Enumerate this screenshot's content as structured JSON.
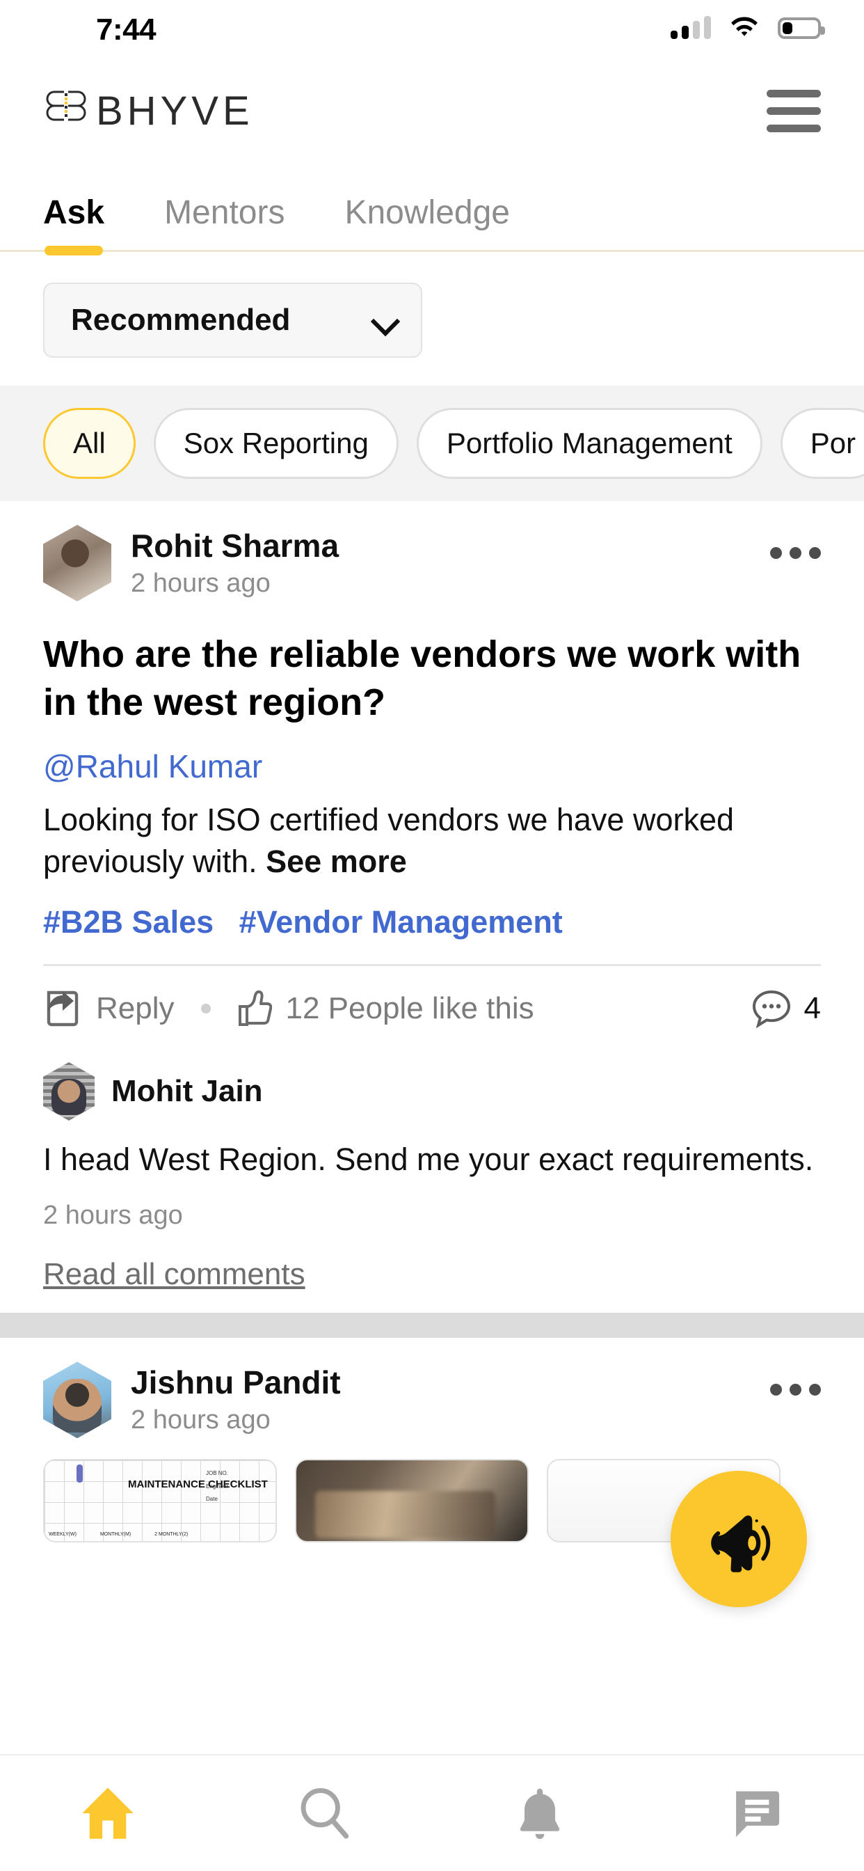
{
  "status_bar": {
    "time": "7:44",
    "signal_icon": "cellular-signal-icon",
    "signal_bars_filled": 2,
    "signal_bars_total": 4,
    "wifi_icon": "wifi-icon",
    "battery_icon": "battery-icon",
    "battery_level_percent": 30
  },
  "header": {
    "logo_text": "BHYVE",
    "logo_mark": "bhyve-butterfly-logo",
    "menu_icon": "hamburger-menu-icon"
  },
  "tabs": [
    {
      "label": "Ask",
      "active": true
    },
    {
      "label": "Mentors",
      "active": false
    },
    {
      "label": "Knowledge",
      "active": false
    }
  ],
  "sort": {
    "selected": "Recommended",
    "chevron_icon": "chevron-down-icon"
  },
  "filter_chips": [
    {
      "label": "All",
      "active": true
    },
    {
      "label": "Sox Reporting",
      "active": false
    },
    {
      "label": "Portfolio Management",
      "active": false
    },
    {
      "label": "Por",
      "active": false
    }
  ],
  "posts": [
    {
      "author": "Rohit Sharma",
      "time": "2 hours ago",
      "avatar": "user-avatar-rohit",
      "menu_icon": "post-options-icon",
      "title": "Who are the reliable vendors we work with in the west region?",
      "mention": "@Rahul Kumar",
      "body_text": "Looking for ISO certified vendors we have worked previously with.",
      "see_more": "See more",
      "tags": [
        "#B2B Sales",
        "#Vendor Management"
      ],
      "actions": {
        "reply_label": "Reply",
        "reply_icon": "reply-arrow-icon",
        "like_icon": "thumbs-up-icon",
        "likes_label": "12 People like this",
        "comment_icon": "comment-bubble-icon",
        "comment_count": "4"
      },
      "comment": {
        "author": "Mohit Jain",
        "avatar": "user-avatar-mohit",
        "text": "I head West Region. Send me your exact requirements.",
        "time": "2 hours ago"
      },
      "read_all_comments": "Read all comments"
    },
    {
      "author": "Jishnu Pandit",
      "time": "2 hours ago",
      "avatar": "user-avatar-jishnu",
      "menu_icon": "post-options-icon",
      "attachments": [
        {
          "type": "document",
          "title": "MAINTENANCE CHECKLIST",
          "field_job_no": "JOB NO.",
          "field_engineer": "Engineer",
          "field_date": "Date",
          "check_weekly": "WEEKLY(W)",
          "check_monthly": "MONTHLY(M)",
          "check_bimonthly": "2 MONTHLY(2)"
        },
        {
          "type": "photo"
        },
        {
          "type": "blank"
        }
      ]
    }
  ],
  "fab": {
    "icon": "megaphone-icon",
    "color": "#fbc72c"
  },
  "bottom_nav": [
    {
      "icon": "home-icon",
      "active": true
    },
    {
      "icon": "search-icon",
      "active": false
    },
    {
      "icon": "bell-icon",
      "active": false
    },
    {
      "icon": "chat-icon",
      "active": false
    }
  ],
  "colors": {
    "accent": "#fdc82f",
    "link": "#4169cf",
    "muted": "#8c8c8c",
    "chip_active_bg": "#fffbe9"
  }
}
